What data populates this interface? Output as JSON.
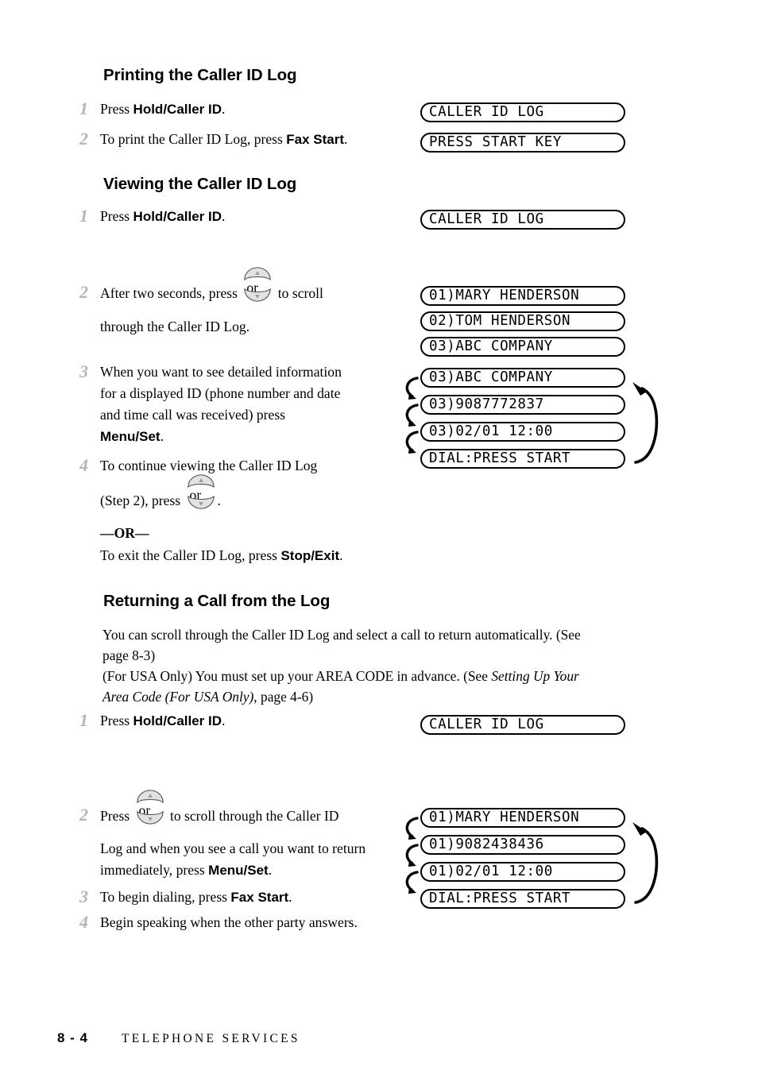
{
  "page": {
    "footer_page_number": "8 - 4",
    "footer_title": "TELEPHONE SERVICES"
  },
  "sections": [
    {
      "heading": "Printing the Caller ID Log",
      "steps": [
        {
          "number": "1",
          "text_html": "Press <b>Hold/Caller ID</b>."
        },
        {
          "number": "2",
          "text_html": "To print the Caller ID Log, press <b>Fax Start</b>."
        }
      ]
    },
    {
      "heading": "Viewing the Caller ID Log",
      "steps": [
        {
          "number": "1",
          "text_html": "Press <b>Hold/Caller ID</b>."
        },
        {
          "number": "2",
          "text_html": "After two seconds, press [updown] to scroll through the Caller ID Log."
        },
        {
          "number": "3",
          "text_html": "When you want to see detailed information for a displayed ID (phone number and date and time call was received) press <b>Menu/Set</b>."
        },
        {
          "number": "4",
          "text_html": "To continue viewing the Caller ID Log (Step 2), press [updown] ."
        }
      ],
      "or_divider": "—OR—",
      "or_text_html": "To exit the Caller ID Log, press <b>Stop/Exit</b>."
    },
    {
      "heading": "Returning a Call from the Log",
      "paragraphs": [
        "You can scroll through the Caller ID Log and select a call to return automatically.  (See page 8-3)",
        "(For USA Only) You must set up your AREA CODE in advance. (See Setting Up Your Area Code (For USA Only), page 4-6)"
      ],
      "steps": [
        {
          "number": "1",
          "text_html": "Press <b>Hold/Caller ID</b>."
        },
        {
          "number": "2",
          "text_html": "Press [updown] to scroll through the Caller ID Log and when you see a call you want to return immediately, press <b>Menu/Set</b>."
        },
        {
          "number": "3",
          "text_html": "To begin dialing, press <b>Fax Start</b>."
        },
        {
          "number": "4",
          "text_html": "Begin speaking when the other party answers."
        }
      ]
    }
  ],
  "text": {
    "printing_heading": "Printing the Caller ID Log",
    "viewing_heading": "Viewing the Caller ID Log",
    "returning_heading": "Returning a Call from the Log",
    "p1_num": "1",
    "p1_pre": "Press ",
    "p1_bold": "Hold/Caller ID",
    "p1_post": ".",
    "p2_num": "2",
    "p2_pre": "To print the Caller ID Log, press ",
    "p2_bold": "Fax Start",
    "p2_post": ".",
    "v1_num": "1",
    "v1_pre": "Press ",
    "v1_bold": "Hold/Caller ID",
    "v1_post": ".",
    "v2_num": "2",
    "v2_pre": "After two seconds, press ",
    "v2_mid": " to scroll",
    "v2_line2": "through the Caller ID Log.",
    "v3_num": "3",
    "v3_line1": "When you want to see detailed information",
    "v3_line2": "for a displayed ID (phone number and date",
    "v3_line3": "and time call was received) press",
    "v3_bold": "Menu/Set",
    "v3_post": ".",
    "v4_num": "4",
    "v4_line1": "To continue viewing the Caller ID Log",
    "v4_line2_pre": "(Step 2), press ",
    "v4_line2_post": ".",
    "v4_or": "—OR—",
    "v4_exit_pre": "To exit the Caller ID Log, press ",
    "v4_exit_bold": "Stop/Exit",
    "v4_exit_post": ".",
    "r_para1_line1": "You can scroll through the Caller ID Log and select a call to return automatically.  (See",
    "r_para1_line2": "page 8-3)",
    "r_para2_line1_pre": "(For USA Only) You must set up your AREA CODE in advance. (See ",
    "r_para2_line1_ital": "Setting Up Your",
    "r_para2_line2_ital": "Area Code (For USA Only)",
    "r_para2_line2_post": ", page 4-6)",
    "r1_num": "1",
    "r1_pre": "Press ",
    "r1_bold": "Hold/Caller ID",
    "r1_post": ".",
    "r2_num": "2",
    "r2_pre": "Press ",
    "r2_mid": " to scroll through the Caller ID",
    "r2_line2": "Log and when you see a call you want to return",
    "r2_line3_pre": "immediately, press ",
    "r2_line3_bold": "Menu/Set",
    "r2_line3_post": ".",
    "r3_num": "3",
    "r3_pre": "To begin dialing, press ",
    "r3_bold": "Fax Start",
    "r3_post": ".",
    "r4_num": "4",
    "r4_text": "Begin speaking when the other party answers.",
    "or_label": "or"
  },
  "lcd_displays": {
    "printing": [
      {
        "id": "print-caller-id-log",
        "text": "CALLER ID LOG"
      },
      {
        "id": "press-start-key",
        "text": "PRESS START KEY"
      }
    ],
    "viewing_step1": [
      {
        "id": "view-caller-id-log",
        "text": "CALLER ID LOG"
      }
    ],
    "viewing_step2_list": [
      {
        "id": "entry-01",
        "text": "01)MARY HENDERSON"
      },
      {
        "id": "entry-02",
        "text": "02)TOM HENDERSON"
      },
      {
        "id": "entry-03",
        "text": "03)ABC COMPANY"
      }
    ],
    "viewing_step3_detail": [
      {
        "id": "detail-name",
        "text": "03)ABC COMPANY"
      },
      {
        "id": "detail-number",
        "text": "03)9087772837"
      },
      {
        "id": "detail-date",
        "text": "03)02/01 12:00"
      },
      {
        "id": "detail-dial",
        "text": "DIAL:PRESS START"
      }
    ],
    "returning_step1": [
      {
        "id": "return-caller-id-log",
        "text": "CALLER ID LOG"
      }
    ],
    "returning_detail": [
      {
        "id": "return-name",
        "text": "01)MARY HENDERSON"
      },
      {
        "id": "return-number",
        "text": "01)9082438436"
      },
      {
        "id": "return-date",
        "text": "01)02/01 12:00"
      },
      {
        "id": "return-dial",
        "text": "DIAL:PRESS START"
      }
    ]
  },
  "colors": {
    "text": "#000000",
    "step_number": "#b5b5b5",
    "key_icon_fill": "#e2e2e2",
    "page_background": "#ffffff"
  },
  "icons": {
    "up_down_key": "up-down-arrow-key-icon",
    "hook_arrow": "curved-hook-arrow-icon",
    "loop_arrow": "curved-loop-arrow-icon"
  }
}
